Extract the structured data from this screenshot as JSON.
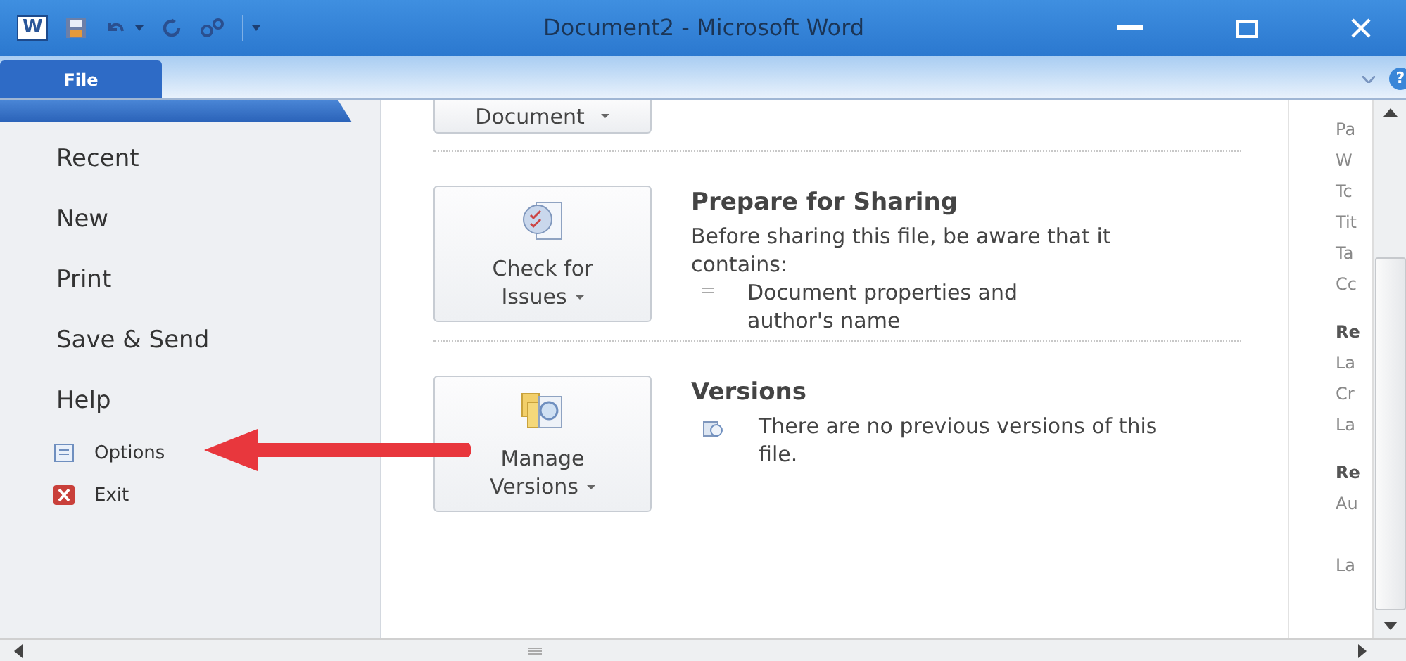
{
  "window": {
    "app_icon": "W",
    "title": "Document2 - Microsoft Word"
  },
  "ribbon": {
    "tabs": [
      {
        "label": "File",
        "selected": true
      }
    ],
    "help": "?"
  },
  "nav": [
    {
      "label": "Recent",
      "kind": "page"
    },
    {
      "label": "New",
      "kind": "page"
    },
    {
      "label": "Print",
      "kind": "page"
    },
    {
      "label": "Save & Send",
      "kind": "page"
    },
    {
      "label": "Help",
      "kind": "page"
    },
    {
      "label": "Options",
      "kind": "command"
    },
    {
      "label": "Exit",
      "kind": "command"
    }
  ],
  "top_button": {
    "label": "Document"
  },
  "sections": [
    {
      "kind": "inspect",
      "button_lines": [
        "Check for",
        "Issues"
      ],
      "title": "Prepare for Sharing",
      "text": "Before sharing this file, be aware that it contains:",
      "bullets": [
        "Document properties and author's name"
      ]
    },
    {
      "kind": "versions",
      "button_lines": [
        "Manage",
        "Versions"
      ],
      "title": "Versions",
      "note": "There are no previous versions of this file."
    }
  ],
  "properties_pane": [
    {
      "text": "Pa",
      "kind": "label"
    },
    {
      "text": "W",
      "kind": "label"
    },
    {
      "text": "Tc",
      "kind": "label"
    },
    {
      "text": "Tit",
      "kind": "label"
    },
    {
      "text": "Ta",
      "kind": "label"
    },
    {
      "text": "Cc",
      "kind": "label"
    },
    {
      "text": "Re",
      "kind": "heading"
    },
    {
      "text": "La",
      "kind": "label"
    },
    {
      "text": "Cr",
      "kind": "label"
    },
    {
      "text": "La",
      "kind": "label"
    },
    {
      "text": "Re",
      "kind": "heading"
    },
    {
      "text": "Au",
      "kind": "label"
    },
    {
      "text": "La",
      "kind": "spaced"
    }
  ]
}
